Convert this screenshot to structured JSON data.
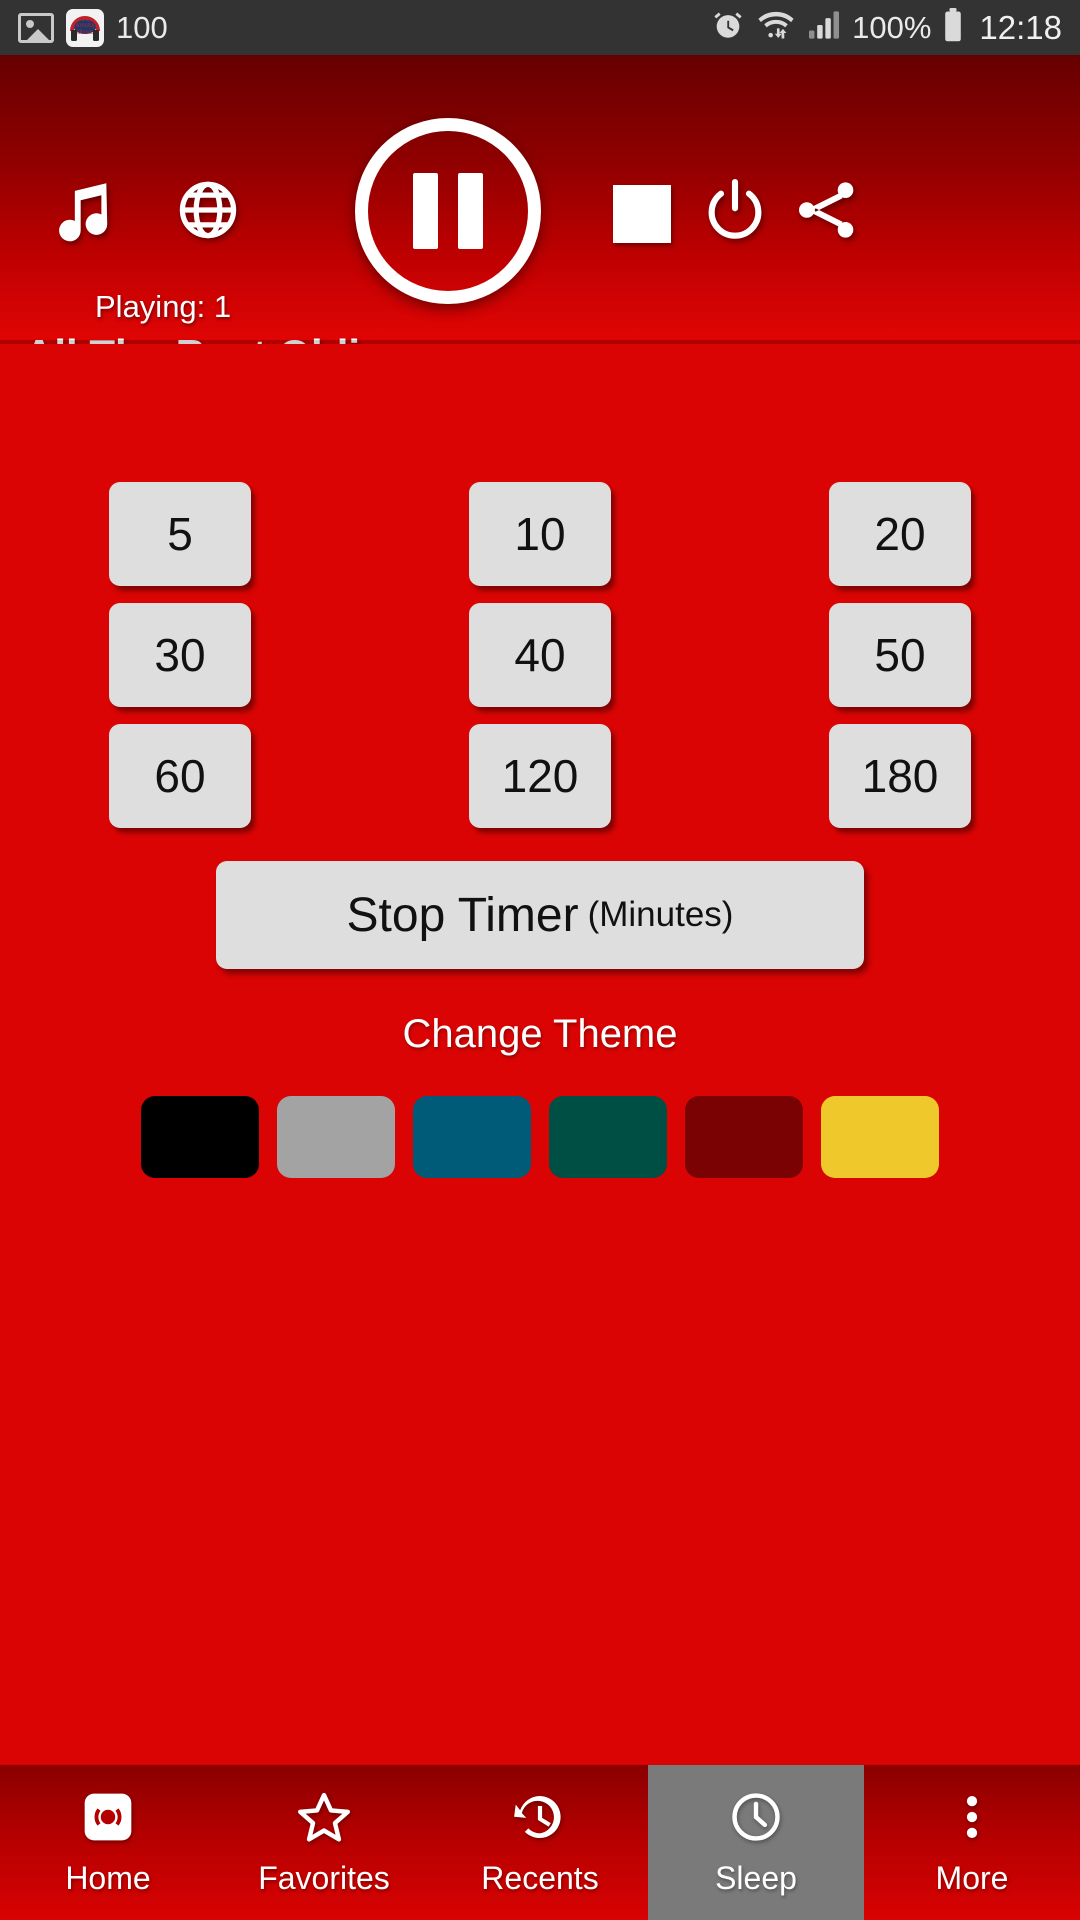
{
  "statusbar": {
    "left_icons": [
      "image-icon",
      "app-notification-icon"
    ],
    "notification_count": "100",
    "right_icons": [
      "alarm-icon",
      "wifi-icon",
      "signal-icon",
      "battery-icon"
    ],
    "battery_percent": "100%",
    "time": "12:18"
  },
  "player": {
    "music_icon": "music-note-icon",
    "globe_icon": "globe-icon",
    "playing_label": "Playing: 1",
    "pause_icon": "pause-icon",
    "stop_icon": "stop-icon",
    "power_icon": "power-icon",
    "share_icon": "share-icon",
    "station_title": "All The Best Oldies"
  },
  "sleep": {
    "timers": [
      "5",
      "10",
      "20",
      "30",
      "40",
      "50",
      "60",
      "120",
      "180"
    ],
    "stop_timer_label": "Stop Timer",
    "stop_timer_unit": "(Minutes)",
    "change_theme_label": "Change Theme",
    "themes": [
      {
        "name": "black",
        "color": "#000000"
      },
      {
        "name": "gray",
        "color": "#A3A3A3"
      },
      {
        "name": "blue",
        "color": "#005B79"
      },
      {
        "name": "green",
        "color": "#004F44"
      },
      {
        "name": "maroon",
        "color": "#7A0202"
      },
      {
        "name": "yellow",
        "color": "#EFC92C"
      }
    ]
  },
  "bottom_nav": {
    "items": [
      {
        "label": "Home",
        "icon": "radio-icon",
        "active": false
      },
      {
        "label": "Favorites",
        "icon": "star-icon",
        "active": false
      },
      {
        "label": "Recents",
        "icon": "history-icon",
        "active": false
      },
      {
        "label": "Sleep",
        "icon": "clock-icon",
        "active": true
      },
      {
        "label": "More",
        "icon": "more-vert-icon",
        "active": false
      }
    ]
  },
  "colors": {
    "background": "#DB0404",
    "header_top": "#660000",
    "header_bottom": "#E00505",
    "button_face": "#DEDEDE",
    "active_tab": "#7A7A7A",
    "statusbar": "#333333"
  }
}
